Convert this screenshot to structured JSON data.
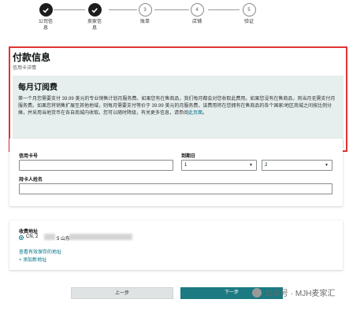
{
  "steps": [
    {
      "label_line1": "公司信",
      "label_line2": "息",
      "state": "done"
    },
    {
      "label_line1": "卖家信",
      "label_line2": "息",
      "state": "done"
    },
    {
      "number": "3",
      "label_line1": "账单",
      "label_line2": "",
      "state": "todo"
    },
    {
      "number": "4",
      "label_line1": "店铺",
      "label_line2": "",
      "state": "todo"
    },
    {
      "number": "5",
      "label_line1": "验证",
      "label_line2": "",
      "state": "todo"
    }
  ],
  "payment": {
    "title": "付款信息",
    "subtitle": "信用卡详情",
    "plan_title": "每月订阅费",
    "plan_desc": "第一个月您需要支付 39.99 美元的专业销售计划月服务费。如果您有在售商品，我们每月都会对您收取此费用。如果您没有在售商品，则当月无需支付月服务费。如果您将销售扩展至其他地域，则每月需要支付等价于 39.99 美元的月服务费，该费用将在您拥有在售商品的各个国家/地区商城之间按比例分摊，并采用当地货币在各自商城内收取。您可以随时降级，有关更多信息，请参阅",
    "plan_link": "此页面",
    "plan_end": "。"
  },
  "card_form": {
    "card_number_label": "信用卡号",
    "expiry_label": "到期日",
    "expiry_month": "1",
    "expiry_year": "2",
    "cardholder_label": "持卡人姓名"
  },
  "billing": {
    "label": "收费地址",
    "address_prefix": "CN, 2",
    "address_part2": "5 山东",
    "view_saved": "查看有效保存的地址",
    "add_new": "+ 添加新地址"
  },
  "buttons": {
    "prev": "上一步",
    "next": "下一步"
  },
  "watermark": "公众号 · MJH麦家汇",
  "colors": {
    "highlight_border": "#e03434",
    "next_button": "#1c7a82",
    "link": "#007185"
  }
}
